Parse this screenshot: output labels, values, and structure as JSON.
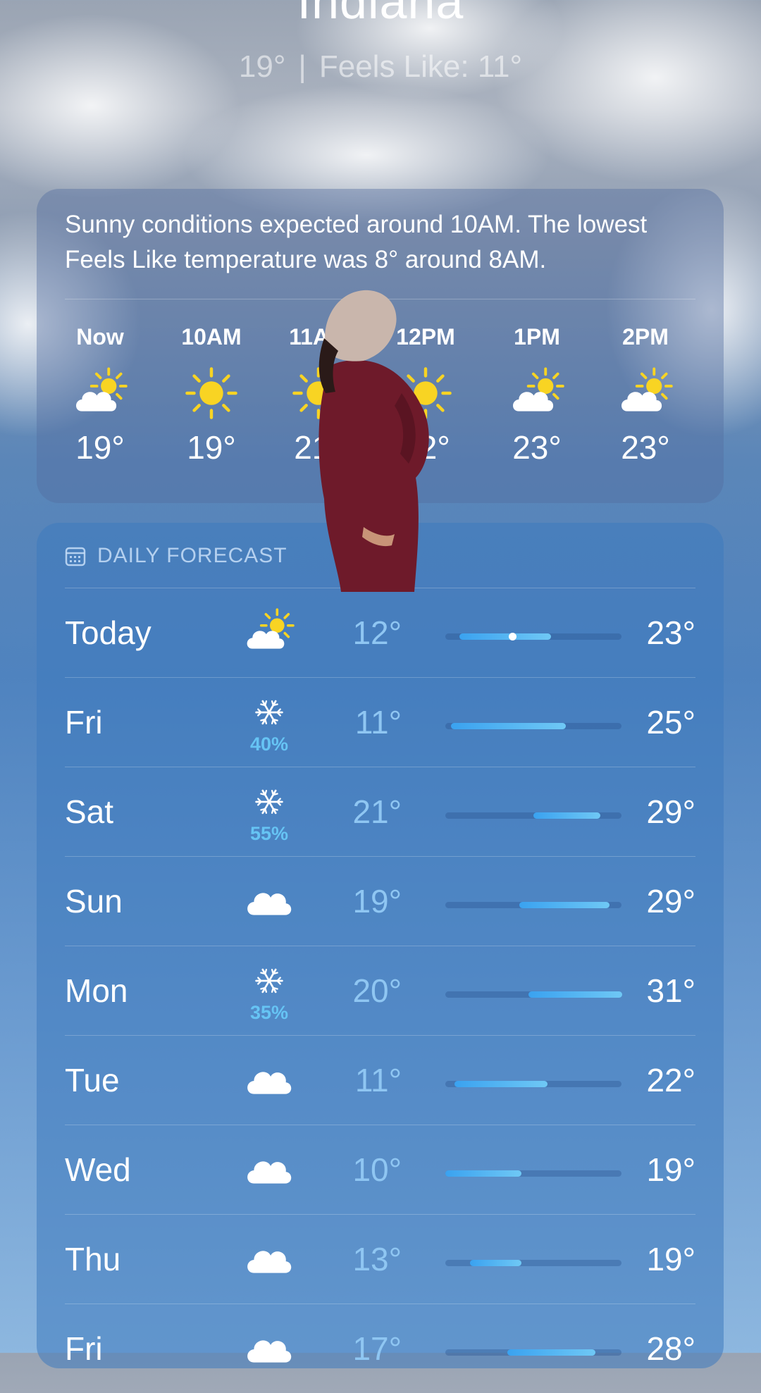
{
  "location": {
    "city": "Indiana",
    "current_temp": "19°",
    "feels_like": "Feels Like: 11°"
  },
  "hourly": {
    "summary": "Sunny conditions expected around 10AM. The lowest Feels Like temperature was 8° around 8AM.",
    "hours": [
      {
        "time": "Now",
        "icon": "partly-sunny-icon",
        "temp": "19°"
      },
      {
        "time": "10AM",
        "icon": "sun-icon",
        "temp": "19°"
      },
      {
        "time": "11AM",
        "icon": "sun-icon",
        "temp": "21°"
      },
      {
        "time": "12PM",
        "icon": "sun-icon",
        "temp": "22°"
      },
      {
        "time": "1PM",
        "icon": "partly-sunny-icon",
        "temp": "23°"
      },
      {
        "time": "2PM",
        "icon": "partly-sunny-icon",
        "temp": "23°"
      }
    ]
  },
  "daily": {
    "title": "DAILY FORECAST",
    "days": [
      {
        "day": "Today",
        "icon": "partly-sunny-icon",
        "precip": "",
        "low": "12°",
        "high": "23°",
        "bar_start": 0.08,
        "bar_end": 0.6,
        "current": 0.38
      },
      {
        "day": "Fri",
        "icon": "snowflake-icon",
        "precip": "40%",
        "low": "11°",
        "high": "25°",
        "bar_start": 0.03,
        "bar_end": 0.68
      },
      {
        "day": "Sat",
        "icon": "snowflake-icon",
        "precip": "55%",
        "low": "21°",
        "high": "29°",
        "bar_start": 0.5,
        "bar_end": 0.88
      },
      {
        "day": "Sun",
        "icon": "cloud-icon",
        "precip": "",
        "low": "19°",
        "high": "29°",
        "bar_start": 0.42,
        "bar_end": 0.93
      },
      {
        "day": "Mon",
        "icon": "snowflake-icon",
        "precip": "35%",
        "low": "20°",
        "high": "31°",
        "bar_start": 0.47,
        "bar_end": 1.0
      },
      {
        "day": "Tue",
        "icon": "cloud-icon",
        "precip": "",
        "low": "11°",
        "high": "22°",
        "bar_start": 0.05,
        "bar_end": 0.58
      },
      {
        "day": "Wed",
        "icon": "cloud-icon",
        "precip": "",
        "low": "10°",
        "high": "19°",
        "bar_start": 0.0,
        "bar_end": 0.43
      },
      {
        "day": "Thu",
        "icon": "cloud-icon",
        "precip": "",
        "low": "13°",
        "high": "19°",
        "bar_start": 0.14,
        "bar_end": 0.43
      },
      {
        "day": "Fri",
        "icon": "cloud-icon",
        "precip": "",
        "low": "17°",
        "high": "28°",
        "bar_start": 0.35,
        "bar_end": 0.85
      }
    ]
  },
  "colors": {
    "accent": "#66c4f4",
    "sun": "#f8d423",
    "bar": "#4fb4f2"
  }
}
